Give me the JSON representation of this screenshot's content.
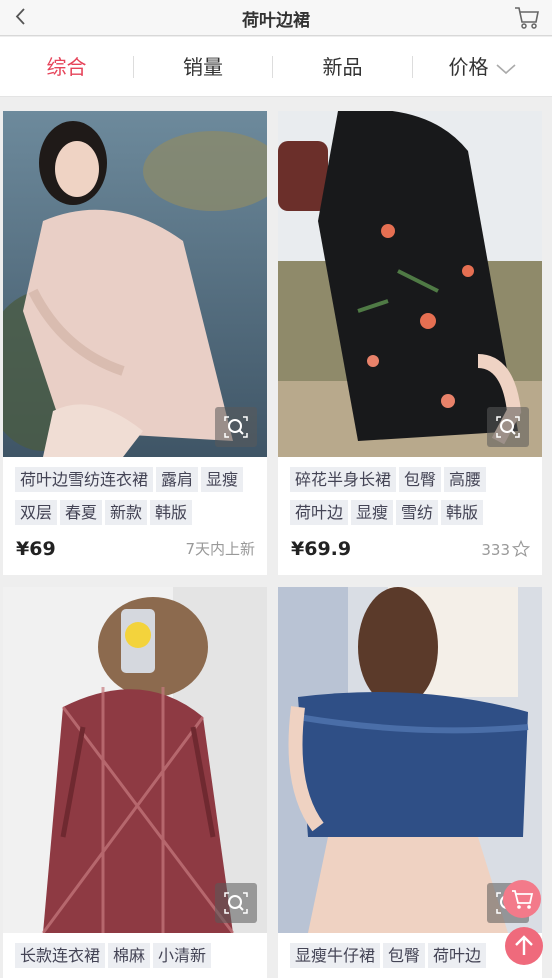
{
  "header": {
    "title": "荷叶边裙"
  },
  "sort": {
    "tabs": [
      "综合",
      "销量",
      "新品",
      "价格"
    ],
    "active_index": 0
  },
  "products": [
    {
      "tags": [
        "荷叶边雪纺连衣裙",
        "露肩",
        "显瘦",
        "双层",
        "春夏",
        "新款",
        "韩版"
      ],
      "price": "¥69",
      "meta": "7天内上新"
    },
    {
      "tags": [
        "碎花半身长裙",
        "包臀",
        "高腰",
        "荷叶边",
        "显瘦",
        "雪纺",
        "韩版"
      ],
      "price": "¥69.9",
      "meta": "333"
    },
    {
      "tags": [
        "长款连衣裙",
        "棉麻",
        "小清新"
      ]
    },
    {
      "tags": [
        "显瘦牛仔裙",
        "包臀",
        "荷叶边"
      ]
    }
  ],
  "colors": {
    "accent": "#e6445a",
    "fab": "#ef6a7c"
  },
  "icons": [
    "back-icon",
    "cart-icon",
    "chevron-down-icon",
    "zoom-icon",
    "star-icon",
    "arrow-up-icon"
  ]
}
